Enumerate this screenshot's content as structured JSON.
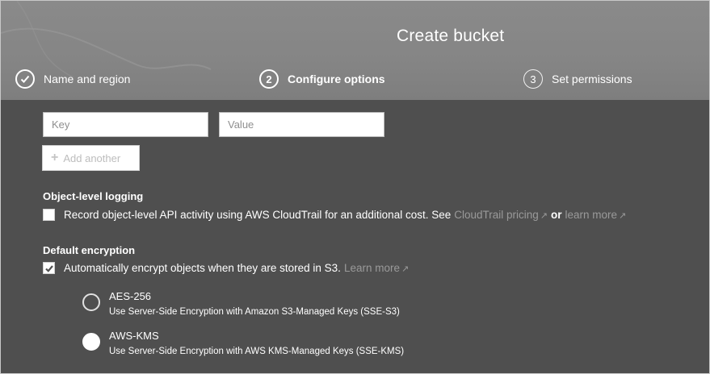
{
  "header": {
    "title": "Create bucket",
    "steps": [
      {
        "number": "",
        "label": "Name and region",
        "state": "done"
      },
      {
        "number": "2",
        "label": "Configure options",
        "state": "active"
      },
      {
        "number": "3",
        "label": "Set permissions",
        "state": "inactive"
      }
    ]
  },
  "tags": {
    "key_placeholder": "Key",
    "value_placeholder": "Value",
    "add_label": "Add another"
  },
  "logging": {
    "heading": "Object-level logging",
    "checked": false,
    "text": "Record object-level API activity using AWS CloudTrail for an additional cost. See",
    "link1": "CloudTrail pricing",
    "or_text": "or",
    "link2": "learn more"
  },
  "encryption": {
    "heading": "Default encryption",
    "checked": true,
    "text": "Automatically encrypt objects when they are stored in S3.",
    "link": "Learn more",
    "options": [
      {
        "title": "AES-256",
        "description": "Use Server-Side Encryption with Amazon S3-Managed Keys (SSE-S3)",
        "selected": false
      },
      {
        "title": "AWS-KMS",
        "description": "Use Server-Side Encryption with AWS KMS-Managed Keys (SSE-KMS)",
        "selected": true
      }
    ]
  },
  "colors": {
    "panel_bg": "#4f4f4f",
    "header_bg": "#858585",
    "link_color": "#9a9a9a",
    "text": "#ffffff"
  }
}
